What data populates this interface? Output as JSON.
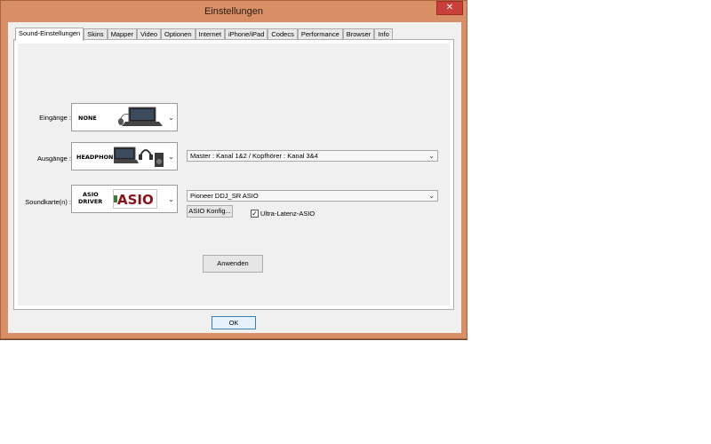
{
  "window": {
    "title": "Einstellungen",
    "close_glyph": "✕"
  },
  "tabs": [
    {
      "label": "Sound-Einstellungen"
    },
    {
      "label": "Skins"
    },
    {
      "label": "Mapper"
    },
    {
      "label": "Video"
    },
    {
      "label": "Optionen"
    },
    {
      "label": "Internet"
    },
    {
      "label": "iPhone/iPad"
    },
    {
      "label": "Codecs"
    },
    {
      "label": "Performance"
    },
    {
      "label": "Browser"
    },
    {
      "label": "Info"
    }
  ],
  "sound": {
    "inputs_label": "Eingänge :",
    "inputs_device": "NONE",
    "outputs_label": "Ausgänge :",
    "outputs_device": "HEADPHONES",
    "outputs_routing": "Master : Kanal 1&2 / Kopfhörer : Kanal 3&4",
    "soundcard_label": "Soundkarte(n) :",
    "soundcard_device_line1": "ASIO",
    "soundcard_device_line2": "DRIVER",
    "soundcard_logo": "ASIO",
    "soundcard_driver": "Pioneer DDJ_SR ASIO",
    "asio_config_label": "ASIO Konfig...",
    "ultra_latency_label": "Ultra-Latenz-ASIO",
    "ultra_latency_checked": true,
    "apply_label": "Anwenden"
  },
  "footer": {
    "ok_label": "OK"
  }
}
